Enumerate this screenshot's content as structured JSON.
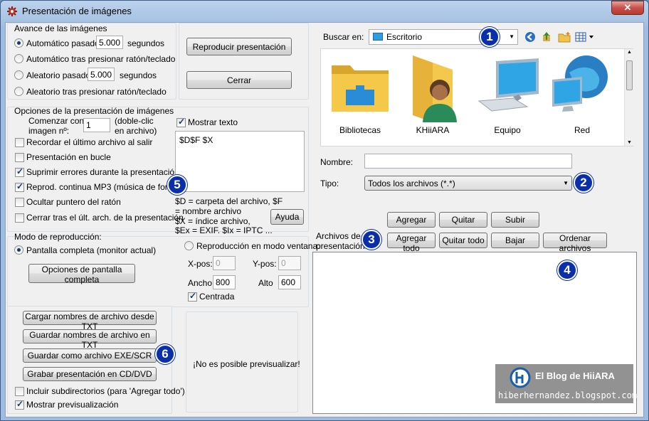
{
  "window": {
    "title": "Presentación de imágenes",
    "close_label": "✕"
  },
  "advance": {
    "group_label": "Avance de las imágenes",
    "auto_time_label": "Automático pasados",
    "auto_time_value": "5.000",
    "auto_time_unit": "segundos",
    "auto_click_label": "Automático tras presionar ratón/teclado",
    "random_time_label": "Aleatorio pasados",
    "random_time_value": "5.000",
    "random_time_unit": "segundos",
    "random_click_label": "Aleatorio tras presionar ratón/teclado"
  },
  "actions": {
    "play_label": "Reproducir presentación",
    "close_label": "Cerrar"
  },
  "options": {
    "group_label": "Opciones de la presentación de imágenes",
    "start_with_label_1": "Comenzar con",
    "start_with_label_2": "imagen nº:",
    "start_with_value": "1",
    "start_with_hint_1": "(doble-clic",
    "start_with_hint_2": "en archivo)",
    "remember_last": "Recordar el último archivo al salir",
    "loop": "Presentación en bucle",
    "suppress_errors": "Suprimir errores durante la presentación",
    "play_mp3": "Reprod. continua MP3 (música de fondo)",
    "hide_pointer": "Ocultar puntero del ratón",
    "close_after_last": "Cerrar tras el últ. arch. de la presentación",
    "show_text_label": "Mostrar texto",
    "text_value": "$D$F $X",
    "help_1": "$D = carpeta del archivo, $F",
    "help_2": "= nombre archivo",
    "help_3": "$X = índice archivo,",
    "help_4": "$Ex = EXIF. $Ix = IPTC ...",
    "help_button": "Ayuda"
  },
  "mode": {
    "group_label": "Modo de reproducción:",
    "fullscreen_label": "Pantalla completa (monitor actual)",
    "fullscreen_options_button": "Opciones de pantalla completa",
    "window_mode_label": "Reproducción en modo ventana:",
    "xpos_label": "X-pos:",
    "xpos_value": "0",
    "ypos_label": "Y-pos:",
    "ypos_value": "0",
    "width_label": "Ancho:",
    "width_value": "800",
    "height_label": "Alto",
    "height_value": "600",
    "centered_label": "Centrada"
  },
  "files": {
    "load_txt": "Cargar nombres de archivo desde TXT",
    "save_txt": "Guardar nombres de archivo en TXT",
    "save_exe": "Guardar como archivo EXE/SCR",
    "burn_cd": "Grabar presentación en CD/DVD",
    "include_subdirs": "Incluir subdirectorios (para 'Agregar todo')",
    "show_preview": "Mostrar previsualización",
    "preview_text": "¡No es posible previsualizar!"
  },
  "browser": {
    "look_in_label": "Buscar en:",
    "look_in_value": "Escritorio",
    "items": [
      {
        "label": "Bibliotecas",
        "icon": "libraries-icon"
      },
      {
        "label": "KHiiARA",
        "icon": "user-folder-icon"
      },
      {
        "label": "Equipo",
        "icon": "computer-icon"
      },
      {
        "label": "Red",
        "icon": "network-icon"
      }
    ],
    "name_label": "Nombre:",
    "name_value": "",
    "type_label": "Tipo:",
    "type_value": "Todos los archivos (*.*)"
  },
  "list": {
    "add": "Agregar",
    "remove": "Quitar",
    "up": "Subir",
    "label_1": "Archivos de la",
    "label_2": "presentación:",
    "add_all": "Agregar todo",
    "remove_all": "Quitar todo",
    "down": "Bajar",
    "sort": "Ordenar archivos"
  },
  "badges": [
    "1",
    "2",
    "3",
    "4",
    "5",
    "6"
  ],
  "watermark": {
    "title": "El Blog de HiiARA",
    "url": "hiberhernandez.blogspot.com"
  }
}
